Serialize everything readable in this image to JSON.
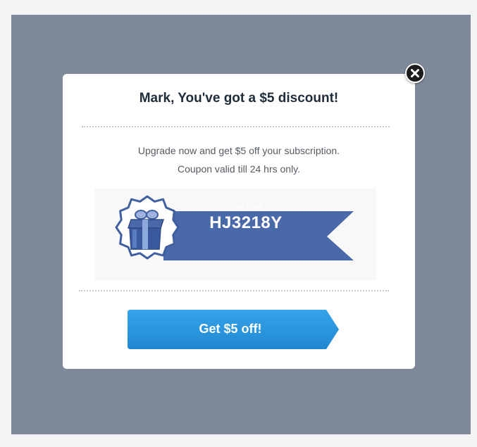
{
  "modal": {
    "title": "Mark, You've got a $5 discount!",
    "description_line1": "Upgrade now and get $5 off your subscription.",
    "description_line2": "Coupon valid till 24 hrs only.",
    "coupon": {
      "label": "Your code",
      "code": "HJ3218Y"
    },
    "cta_label": "Get $5 off!",
    "close_icon": "close-icon",
    "gift_icon": "gift-icon"
  },
  "colors": {
    "backdrop": "#7e8a9a",
    "ribbon": "#4a69a8",
    "cta": "#2b97df",
    "title": "#1f2c3a"
  }
}
